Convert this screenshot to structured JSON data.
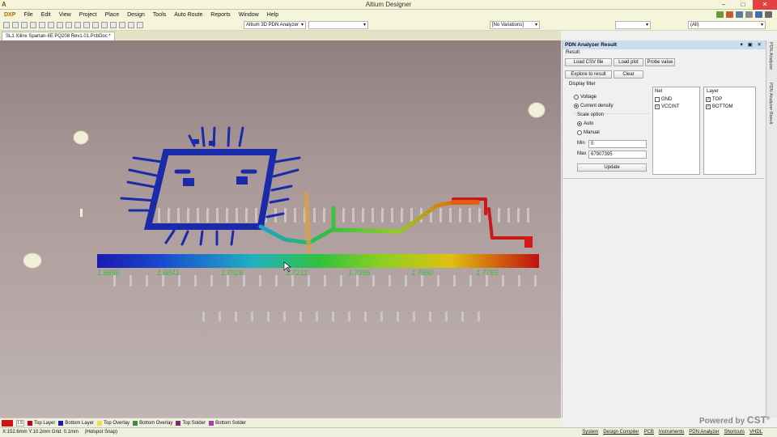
{
  "app": {
    "title": "Altium Designer",
    "menu": [
      "DXP",
      "File",
      "Edit",
      "View",
      "Project",
      "Place",
      "Design",
      "Tools",
      "Auto Route",
      "Reports",
      "Window",
      "Help"
    ],
    "window_buttons": [
      "–",
      "□",
      "✕"
    ]
  },
  "toolbar": {
    "analyzer_select": "Altium 3D PDN Analyzer",
    "variations_select": "[No Variations]",
    "filter_select": "(All)",
    "empty_select_1": "",
    "empty_select_2": ""
  },
  "document_tab": {
    "label": "SL1 Xilinx Spartan-IIE PQ208 Rev1.01.PcbDoc *"
  },
  "colorbar": {
    "labels": [
      "1.6656",
      "1.6841",
      "1.7026",
      "1.7211",
      "1.7396",
      "1.7580",
      "1.7765"
    ]
  },
  "layer_tabs": [
    {
      "label": "Top Layer",
      "color": "#c0001a"
    },
    {
      "label": "Bottom Layer",
      "color": "#1a1aa8"
    },
    {
      "label": "Top Overlay",
      "color": "#f0e050"
    },
    {
      "label": "Bottom Overlay",
      "color": "#3d8c3d"
    },
    {
      "label": "Top Solder",
      "color": "#7a2a6a"
    },
    {
      "label": "Bottom Solder",
      "color": "#a040a0"
    }
  ],
  "layer_switch_label": "LS",
  "status": {
    "coords": "X:152.6mm Y:10.2mm",
    "grid": "Grid: 0.1mm",
    "snap": "(Hotspot Snap)",
    "links": [
      "System",
      "Design Compiler",
      "PCB",
      "Instruments",
      "PDN Analyzer",
      "Shortcuts",
      "VHDL"
    ]
  },
  "panel": {
    "title": "PDN Analyzer Result",
    "title_buttons": "▾ ▣ ✕",
    "result_label": "Result",
    "buttons": {
      "load_csv": "Load CSV file",
      "load_plot": "Load plot",
      "probe_value": "Probe value",
      "explore": "Explore to result",
      "clear": "Clear",
      "update": "Update"
    },
    "display_filter_label": "Display filter",
    "voltage_label": "Voltage",
    "current_density_label": "Current density",
    "mode_selected": "Current density",
    "scale_option_label": "Scale option",
    "auto_label": "Auto",
    "manual_label": "Manual",
    "scale_selected": "Auto",
    "min_label": "Min",
    "min_value": "0",
    "max_label": "Max",
    "max_value": "67907395",
    "net_header": "Net",
    "nets": [
      {
        "name": "GND",
        "checked": false
      },
      {
        "name": "VCCINT",
        "checked": true
      }
    ],
    "layer_header": "Layer",
    "layers": [
      {
        "name": "TOP",
        "checked": true
      },
      {
        "name": "BOTTOM",
        "checked": true
      }
    ]
  },
  "side_tabs": [
    "PDN Analyzer",
    "PDN Analyzer Result"
  ],
  "powered_by": {
    "text": "Powered by",
    "brand": "CST",
    "mark": "®"
  },
  "colors": {
    "title_bg": "#f5f5dc",
    "panel_title_bg": "#c9dcf0",
    "close_button": "#e04343",
    "trace_blue": "#1a2aa8"
  }
}
